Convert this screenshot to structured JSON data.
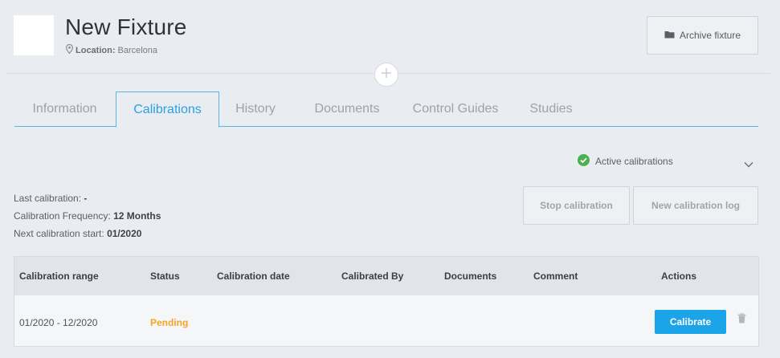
{
  "header": {
    "title": "New Fixture",
    "location_label": "Location:",
    "location_value": "Barcelona",
    "archive_label": "Archive fixture",
    "archive_icon": "folder-icon"
  },
  "tabs": [
    {
      "label": "Information",
      "active": false
    },
    {
      "label": "Calibrations",
      "active": true
    },
    {
      "label": "History",
      "active": false
    },
    {
      "label": "Documents",
      "active": false
    },
    {
      "label": "Control Guides",
      "active": false
    },
    {
      "label": "Studies",
      "active": false
    }
  ],
  "filter": {
    "label": "Active calibrations",
    "icon": "check-circle-icon",
    "icon_color": "#4caf50"
  },
  "calibration_info": {
    "last_label": "Last calibration:",
    "last_value": "-",
    "frequency_label": "Calibration Frequency:",
    "frequency_value": "12 Months",
    "next_label": "Next calibration start:",
    "next_value": "01/2020"
  },
  "actions": {
    "stop_label": "Stop calibration",
    "new_log_label": "New calibration log"
  },
  "table": {
    "columns": [
      "Calibration range",
      "Status",
      "Calibration date",
      "Calibrated By",
      "Documents",
      "Comment",
      "Actions"
    ],
    "rows": [
      {
        "range": "01/2020 - 12/2020",
        "status": "Pending",
        "date": "",
        "calibrated_by": "",
        "documents": "",
        "comment": "",
        "action_label": "Calibrate"
      }
    ]
  },
  "colors": {
    "accent": "#2e9fe0",
    "calibrate_button": "#1ca4e8",
    "pending": "#f5a623"
  }
}
